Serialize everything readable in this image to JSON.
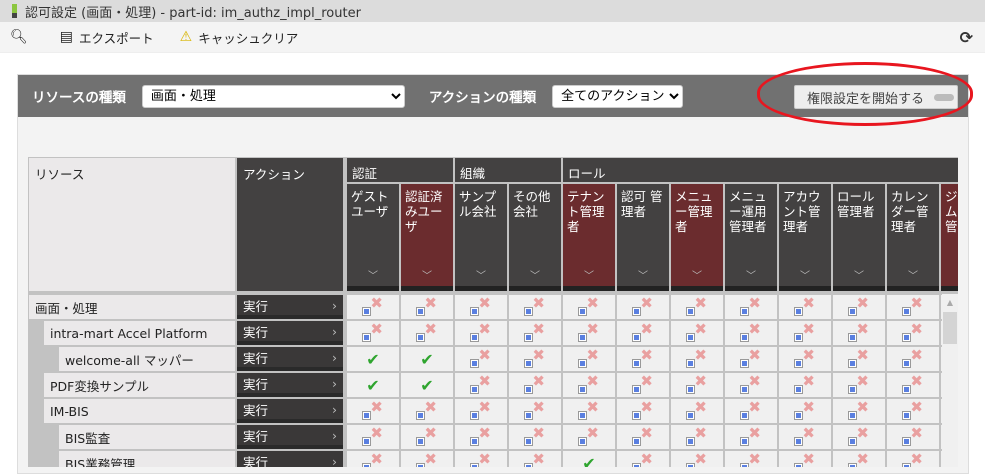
{
  "title": "認可設定 (画面・処理) - part-id: im_authz_impl_router",
  "toolbar": {
    "search_icon": "magnifier-icon",
    "export": "エクスポート",
    "cache_clear": "キャッシュクリア",
    "refresh_icon": "refresh-icon"
  },
  "filters": {
    "resource_label": "リソースの種類",
    "resource_value": "画面・処理",
    "action_label": "アクションの種類",
    "action_value": "全てのアクション",
    "start_button": "権限設定を開始する"
  },
  "annotation_color": "#e8161f",
  "table": {
    "resource_header": "リソース",
    "action_header": "アクション",
    "groups": [
      {
        "label": "認証",
        "span": 2
      },
      {
        "label": "組織",
        "span": 2
      },
      {
        "label": "ロール",
        "span": 8
      }
    ],
    "columns": [
      {
        "label": "ゲスト ユーザ",
        "highlight": false
      },
      {
        "label": "認証済 みユー ザ",
        "highlight": true
      },
      {
        "label": "サンプ ル会社",
        "highlight": false
      },
      {
        "label": "その他 会社",
        "highlight": false
      },
      {
        "label": "テナン ト管理 者",
        "highlight": true
      },
      {
        "label": "認可 管 理者",
        "highlight": false
      },
      {
        "label": "メニュ ー管理 者",
        "highlight": true
      },
      {
        "label": "メニュ ー運用 管理者",
        "highlight": false
      },
      {
        "label": "アカウ ント管 理者",
        "highlight": false
      },
      {
        "label": "ロール 管理者",
        "highlight": false
      },
      {
        "label": "カレン ダー管 理者",
        "highlight": false
      },
      {
        "label": "ジス テム ユー 管理",
        "highlight": true
      }
    ],
    "rows": [
      {
        "name": "画面・処理",
        "level": 0,
        "action": "実行",
        "perms": [
          "deny",
          "deny",
          "deny",
          "deny",
          "deny",
          "deny",
          "deny",
          "deny",
          "deny",
          "deny",
          "deny",
          "deny"
        ]
      },
      {
        "name": "intra-mart Accel Platform",
        "level": 1,
        "action": "実行",
        "perms": [
          "deny",
          "deny",
          "deny",
          "deny",
          "deny",
          "deny",
          "deny",
          "deny",
          "deny",
          "deny",
          "deny",
          "deny"
        ]
      },
      {
        "name": "welcome-all マッパー",
        "level": 2,
        "action": "実行",
        "perms": [
          "allow",
          "allow",
          "deny",
          "deny",
          "deny",
          "deny",
          "deny",
          "deny",
          "deny",
          "deny",
          "deny",
          "deny"
        ]
      },
      {
        "name": "PDF変換サンプル",
        "level": 1,
        "action": "実行",
        "perms": [
          "allow",
          "allow",
          "deny",
          "deny",
          "deny",
          "deny",
          "deny",
          "deny",
          "deny",
          "deny",
          "deny",
          "deny"
        ]
      },
      {
        "name": "IM-BIS",
        "level": 1,
        "action": "実行",
        "perms": [
          "deny",
          "deny",
          "deny",
          "deny",
          "deny",
          "deny",
          "deny",
          "deny",
          "deny",
          "deny",
          "deny",
          "deny"
        ]
      },
      {
        "name": "BIS監査",
        "level": 2,
        "action": "実行",
        "perms": [
          "deny",
          "deny",
          "deny",
          "deny",
          "deny",
          "deny",
          "deny",
          "deny",
          "deny",
          "deny",
          "deny",
          "deny"
        ]
      },
      {
        "name": "BIS業務管理",
        "level": 2,
        "action": "実行",
        "perms": [
          "deny",
          "deny",
          "deny",
          "deny",
          "allow",
          "deny",
          "deny",
          "deny",
          "deny",
          "deny",
          "deny",
          "deny"
        ]
      }
    ]
  }
}
